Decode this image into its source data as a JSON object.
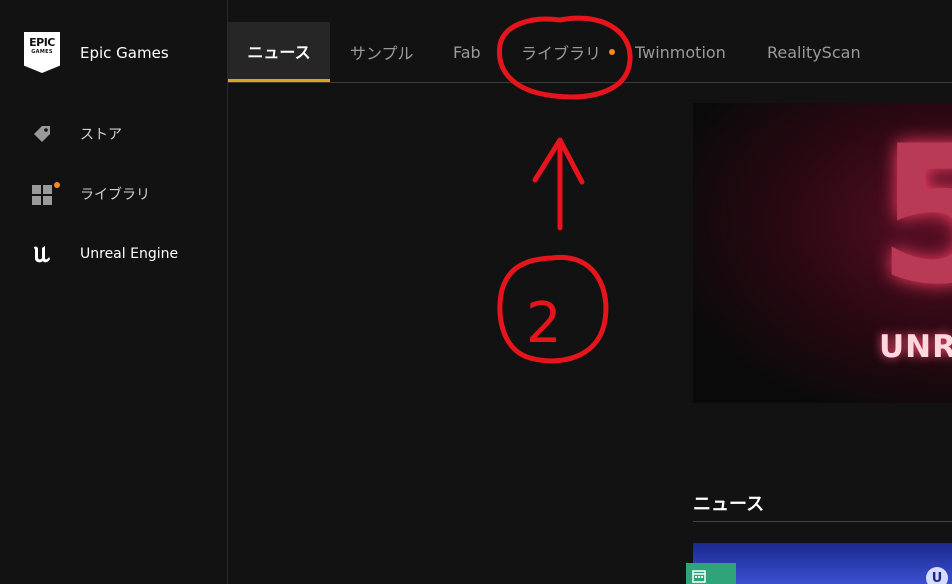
{
  "brand": {
    "logo_line1": "EPIC",
    "logo_line2": "GAMES",
    "name": "Epic Games"
  },
  "sidebar": {
    "items": [
      {
        "label": "ストア",
        "icon": "tag-icon"
      },
      {
        "label": "ライブラリ",
        "icon": "grid-icon",
        "badge": true
      },
      {
        "label": "Unreal Engine",
        "icon": "unreal-logo-icon"
      }
    ]
  },
  "tabs": [
    {
      "label": "ニュース",
      "active": true
    },
    {
      "label": "サンプル"
    },
    {
      "label": "Fab"
    },
    {
      "label": "ライブラリ",
      "badge": true
    },
    {
      "label": "Twinmotion"
    },
    {
      "label": "RealityScan"
    }
  ],
  "hero": {
    "numeral": "5",
    "word": "UNR"
  },
  "news": {
    "heading": "ニュース",
    "card_mark": "U"
  },
  "annotation": {
    "number": "2"
  },
  "colors": {
    "accent": "#e0a418",
    "badge": "#f58a1f",
    "annotation": "#e8141c",
    "background": "#121212"
  }
}
